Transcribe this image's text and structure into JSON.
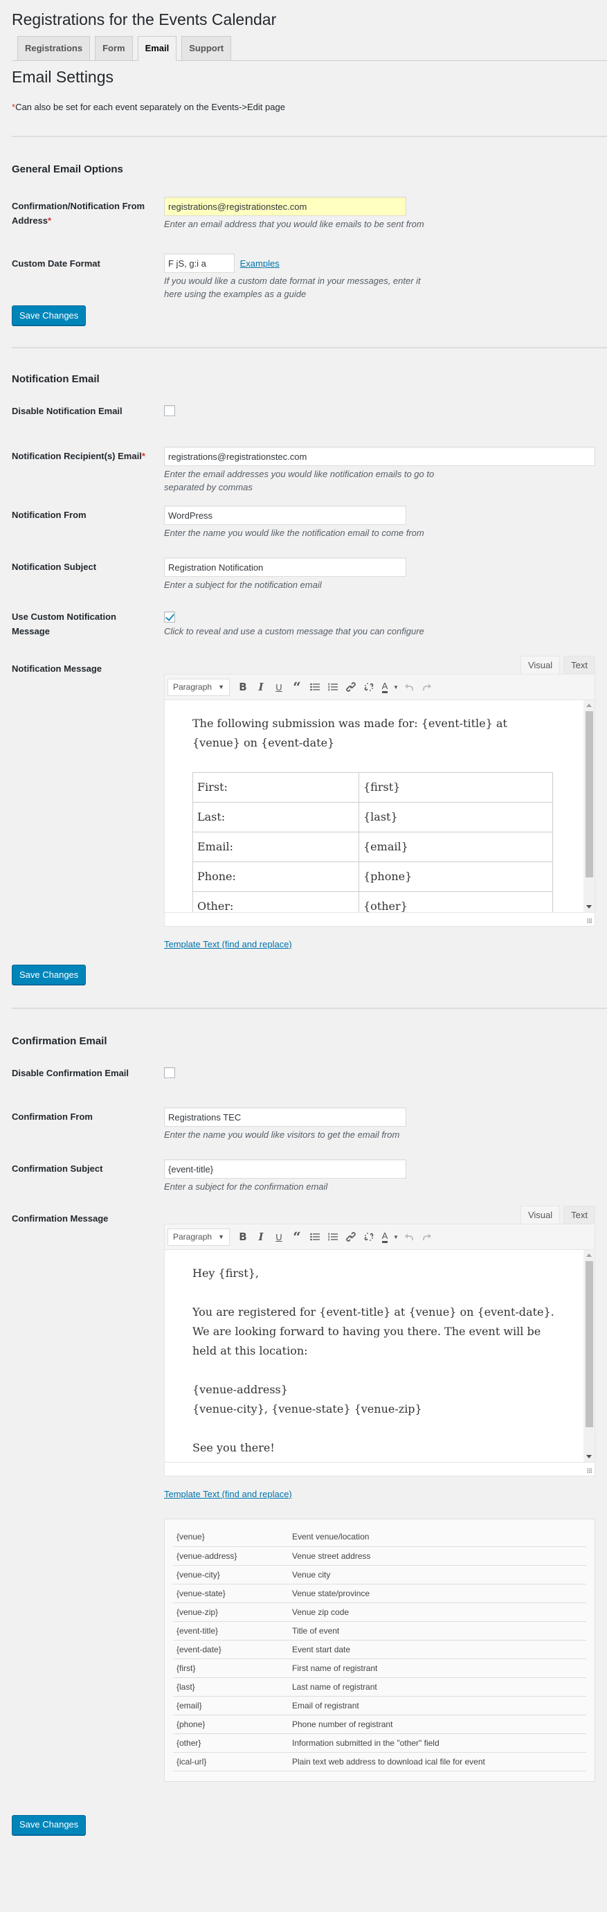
{
  "app_title": "Registrations for the Events Calendar",
  "nav_tabs": [
    {
      "label": "Registrations",
      "active": false
    },
    {
      "label": "Form",
      "active": false
    },
    {
      "label": "Email",
      "active": true
    },
    {
      "label": "Support",
      "active": false
    }
  ],
  "page_title": "Email Settings",
  "note": {
    "asterisk": "*",
    "text": "Can also be set for each event separately on the Events->Edit page"
  },
  "general": {
    "title": "General Email Options",
    "from_address": {
      "label": "Confirmation/Notification From Address",
      "required_mark": "*",
      "value": "registrations@registrationstec.com",
      "description": "Enter an email address that you would like emails to be sent from"
    },
    "date_format": {
      "label": "Custom Date Format",
      "value": "F jS, g:i a",
      "link": "Examples",
      "description": "If you would like a custom date format in your messages, enter it here using the examples as a guide"
    },
    "save_label": "Save Changes"
  },
  "notification": {
    "title": "Notification Email",
    "disable": {
      "label": "Disable Notification Email",
      "checked": false
    },
    "recipients": {
      "label": "Notification Recipient(s) Email",
      "required_mark": "*",
      "value": "registrations@registrationstec.com",
      "description": "Enter the email addresses you would like notification emails to go to separated by commas"
    },
    "from": {
      "label": "Notification From",
      "value": "WordPress",
      "description": "Enter the name you would like the notification email to come from"
    },
    "subject": {
      "label": "Notification Subject",
      "value": "Registration Notification",
      "description": "Enter a subject for the notification email"
    },
    "use_custom": {
      "label": "Use Custom Notification Message",
      "checked": true,
      "description": "Click to reveal and use a custom message that you can configure"
    },
    "message": {
      "label": "Notification Message",
      "intro": "The following submission was made for: {event-title} at {venue} on {event-date}",
      "table": [
        {
          "field": "First:",
          "value": "{first}"
        },
        {
          "field": "Last:",
          "value": "{last}"
        },
        {
          "field": "Email:",
          "value": "{email}"
        },
        {
          "field": "Phone:",
          "value": "{phone}"
        },
        {
          "field": "Other:",
          "value": "{other}"
        }
      ]
    },
    "template_link": "Template Text (find and replace)",
    "save_label": "Save Changes"
  },
  "editor": {
    "tab_visual": "Visual",
    "tab_text": "Text",
    "format_value": "Paragraph",
    "buttons": [
      "bold",
      "italic",
      "underline",
      "blockquote",
      "bullet-list",
      "numbered-list",
      "link",
      "unlink",
      "text-color",
      "undo",
      "redo"
    ]
  },
  "confirmation": {
    "title": "Confirmation Email",
    "disable": {
      "label": "Disable Confirmation Email",
      "checked": false
    },
    "from": {
      "label": "Confirmation From",
      "value": "Registrations TEC",
      "description": "Enter the name you would like visitors to get the email from"
    },
    "subject": {
      "label": "Confirmation Subject",
      "value": "{event-title}",
      "description": "Enter a subject for the confirmation email"
    },
    "message": {
      "label": "Confirmation Message",
      "greeting": "Hey {first},",
      "body": "You are registered for {event-title} at {venue} on {event-date}. We are looking forward to having you there. The event will be held at this location:",
      "address_line1": "{venue-address}",
      "address_line2": "{venue-city}, {venue-state} {venue-zip}",
      "closing": "See you there!"
    },
    "template_link": "Template Text (find and replace)",
    "template_tags": [
      {
        "tag": "{venue}",
        "desc": "Event venue/location"
      },
      {
        "tag": "{venue-address}",
        "desc": "Venue street address"
      },
      {
        "tag": "{venue-city}",
        "desc": "Venue city"
      },
      {
        "tag": "{venue-state}",
        "desc": "Venue state/province"
      },
      {
        "tag": "{venue-zip}",
        "desc": "Venue zip code"
      },
      {
        "tag": "{event-title}",
        "desc": "Title of event"
      },
      {
        "tag": "{event-date}",
        "desc": "Event start date"
      },
      {
        "tag": "{first}",
        "desc": "First name of registrant"
      },
      {
        "tag": "{last}",
        "desc": "Last name of registrant"
      },
      {
        "tag": "{email}",
        "desc": "Email of registrant"
      },
      {
        "tag": "{phone}",
        "desc": "Phone number of registrant"
      },
      {
        "tag": "{other}",
        "desc": "Information submitted in the \"other\" field"
      },
      {
        "tag": "{ical-url}",
        "desc": "Plain text web address to download ical file for event"
      }
    ],
    "save_label": "Save Changes"
  },
  "colors": {
    "primary_button": "#0085ba",
    "link": "#0073aa",
    "required": "#dc3232",
    "highlight_input": "#ffffc0",
    "background": "#f1f1f1"
  }
}
